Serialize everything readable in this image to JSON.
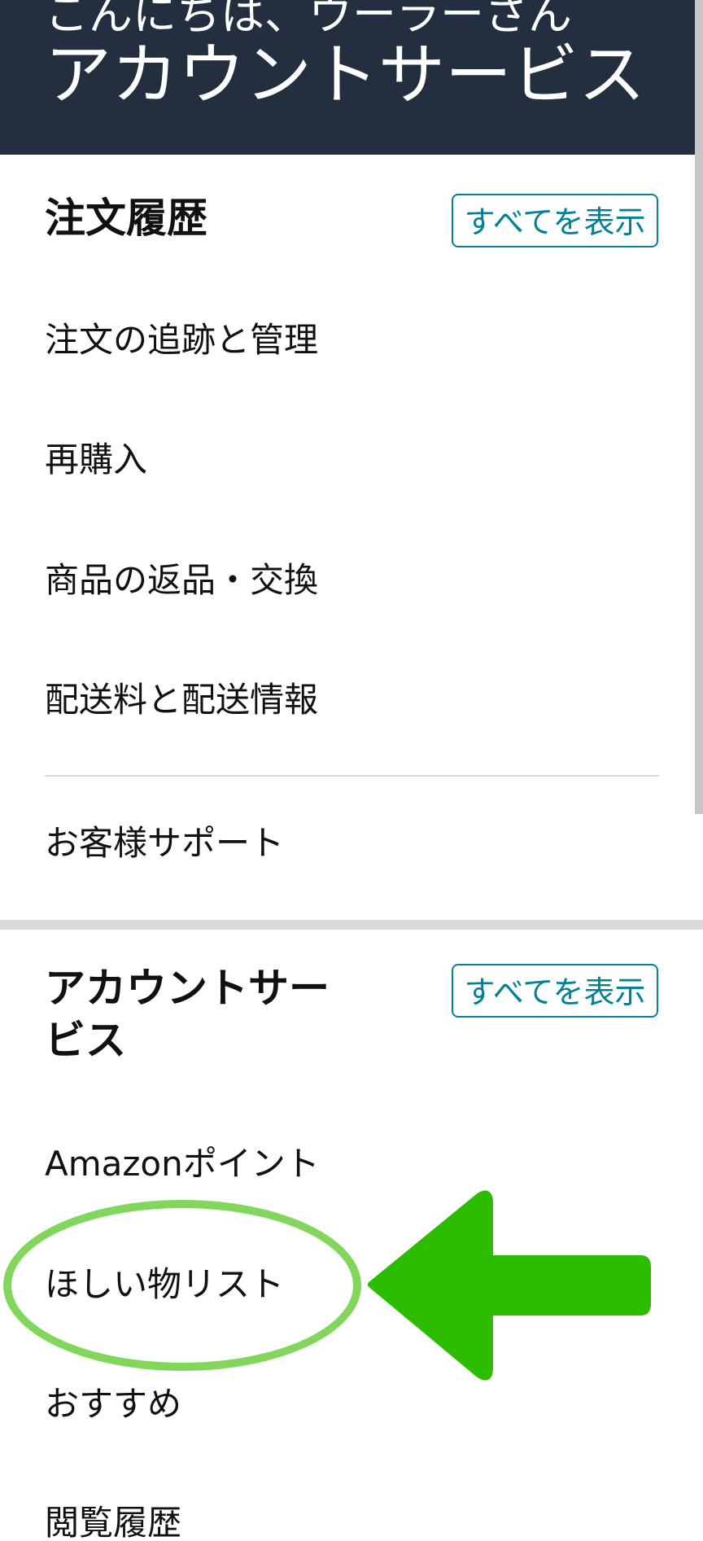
{
  "header": {
    "greeting": "こんにちは、ウーラーさん",
    "title": "アカウントサービス"
  },
  "orders_section": {
    "title": "注文履歴",
    "view_all_label": "すべてを表示",
    "items": [
      {
        "label": "注文の追跡と管理"
      },
      {
        "label": "再購入"
      },
      {
        "label": "商品の返品・交換"
      },
      {
        "label": "配送料と配送情報"
      }
    ],
    "support_label": "お客様サポート"
  },
  "account_section": {
    "title_line1": "アカウントサー",
    "title_line2": "ビス",
    "view_all_label": "すべてを表示",
    "items": [
      {
        "label": "Amazonポイント"
      },
      {
        "label": "ほしい物リスト"
      },
      {
        "label": "おすすめ"
      },
      {
        "label": "閲覧履歴"
      }
    ]
  },
  "colors": {
    "header_bg": "#232f3e",
    "link_teal": "#008296",
    "highlight_green": "#82d65c",
    "arrow_green": "#2dbd00"
  },
  "icons": {
    "annotation_arrow": "left-arrow-icon"
  }
}
